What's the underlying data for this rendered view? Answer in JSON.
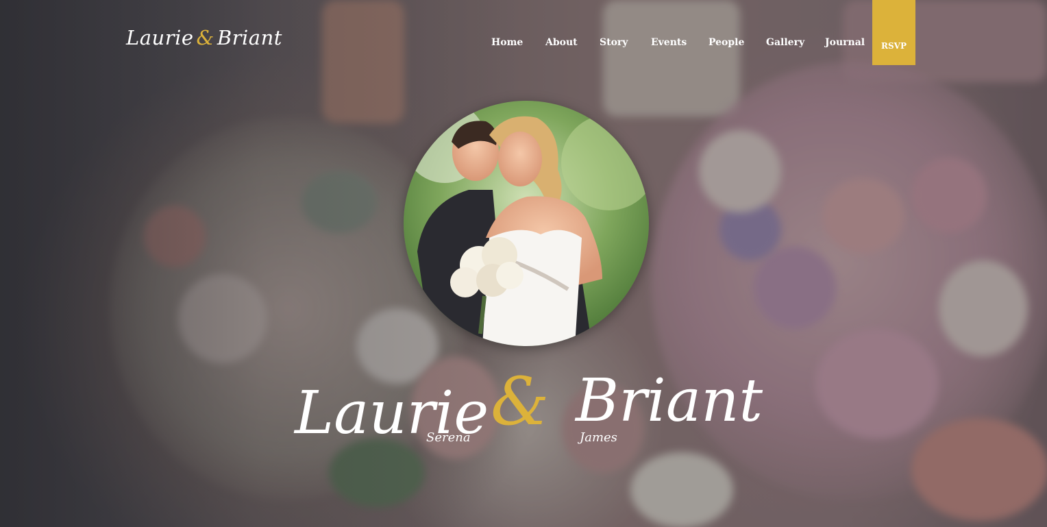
{
  "site": {
    "logo": {
      "first": "Laurie",
      "amp": "&",
      "second": "Briant"
    }
  },
  "nav": {
    "items": [
      {
        "label": "Home"
      },
      {
        "label": "About"
      },
      {
        "label": "Story"
      },
      {
        "label": "Events"
      },
      {
        "label": "People"
      },
      {
        "label": "Gallery"
      },
      {
        "label": "Journal"
      }
    ],
    "rsvp_label": "RSVP"
  },
  "hero": {
    "bride_name": "Laurie",
    "amp": "&",
    "groom_name": "Briant",
    "bride_middle": "Serena",
    "groom_middle": "James"
  },
  "colors": {
    "accent": "#dcb23a",
    "text": "#ffffff"
  }
}
